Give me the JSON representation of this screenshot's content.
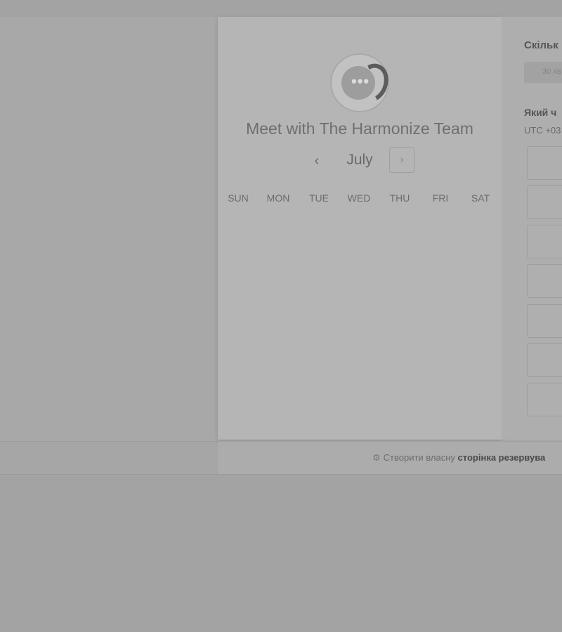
{
  "calendar": {
    "title": "Meet with The Harmonize Team",
    "month": "July",
    "prev_icon": "chevron-left-icon",
    "next_icon": "chevron-right-icon",
    "prev_glyph": "‹",
    "next_glyph": "›",
    "weekdays": [
      "SUN",
      "MON",
      "TUE",
      "WED",
      "THU",
      "FRI",
      "SAT"
    ]
  },
  "options": {
    "duration_question": "Скільк",
    "duration_value": "30 хв",
    "time_question": "Який ч",
    "timezone": "UTC +03",
    "slot_count": 7
  },
  "footer": {
    "icon": "sprocket-icon",
    "text_plain": "Створити власну",
    "text_bold": "сторінка резервува"
  },
  "colors": {
    "overlay": "#a3a3a3",
    "panel": "#b5b5b5",
    "title_text": "#6f6f6f"
  }
}
